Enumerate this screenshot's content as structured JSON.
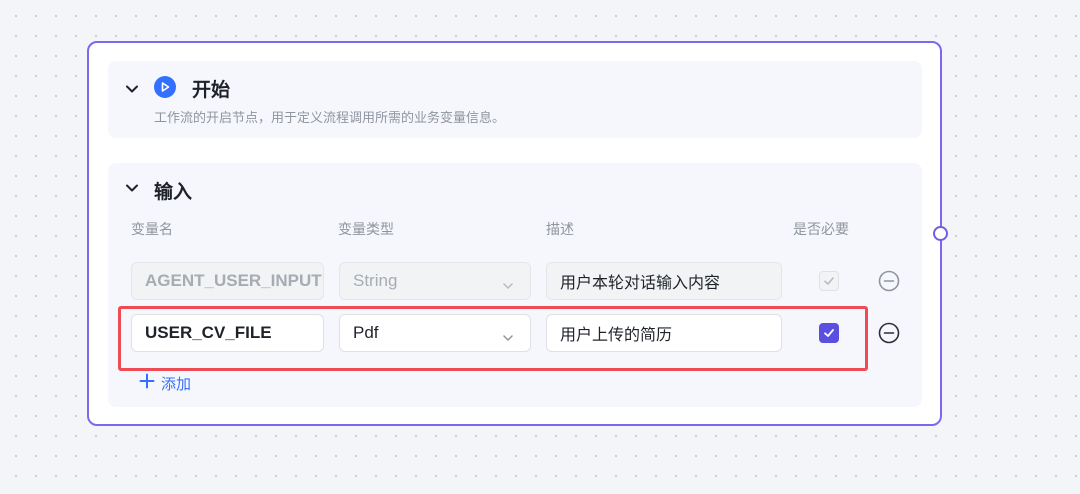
{
  "start": {
    "title": "开始",
    "description": "工作流的开启节点，用于定义流程调用所需的业务变量信息。"
  },
  "input": {
    "title": "输入",
    "columns": {
      "name": "变量名",
      "type": "变量类型",
      "description": "描述",
      "required": "是否必要"
    },
    "rows": [
      {
        "name": "AGENT_USER_INPUT",
        "type": "String",
        "description": "用户本轮对话输入内容",
        "required": true,
        "editable": false
      },
      {
        "name": "USER_CV_FILE",
        "type": "Pdf",
        "description": "用户上传的简历",
        "required": true,
        "editable": true
      }
    ],
    "add_label": "添加"
  },
  "colors": {
    "node_border": "#7b68ee",
    "accent_blue": "#3370ff",
    "checkbox_checked": "#5b4fe0",
    "highlight": "#ef4b54"
  },
  "icons": {
    "start": "play-circle-icon",
    "collapse": "chevron-down-icon",
    "select": "chevron-down-icon",
    "remove": "minus-circle-icon",
    "add": "plus-icon",
    "check": "check-icon"
  }
}
